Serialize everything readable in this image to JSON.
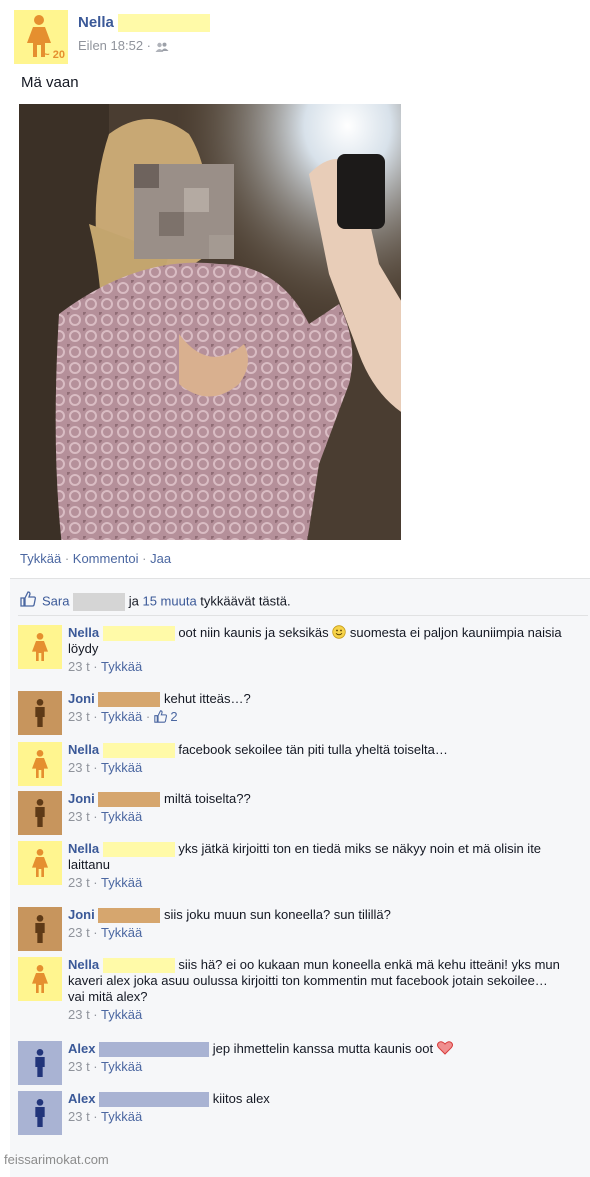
{
  "post": {
    "author": "Nella",
    "age_badge": "~ 20",
    "time": "Eilen 18:52 ·",
    "privacy_icon": "friends-icon",
    "text": "Mä vaan",
    "actions": {
      "like": "Tykkää",
      "comment": "Kommentoi",
      "share": "Jaa",
      "separator": "·"
    }
  },
  "likes": {
    "first_name": "Sara",
    "connector": "ja",
    "others_link": "15 muuta",
    "suffix": "tykkäävät tästä."
  },
  "comments": [
    {
      "author": "Nella",
      "text": "oot niin kaunis ja seksikäs",
      "emoji_after": "smiley-icon",
      "text2": "suomesta ei paljon kauniimpia naisia löydy",
      "time": "23 t",
      "like": "Tykkää",
      "avatar": "female"
    },
    {
      "author": "Joni",
      "text": "kehut itteäs…?",
      "time": "23 t",
      "like": "Tykkää",
      "like_count": "2",
      "avatar": "male-brown"
    },
    {
      "author": "Nella",
      "text": "facebook sekoilee tän piti tulla yheltä toiselta…",
      "time": "23 t",
      "like": "Tykkää",
      "avatar": "female"
    },
    {
      "author": "Joni",
      "text": "miltä toiselta??",
      "time": "23 t",
      "like": "Tykkää",
      "avatar": "male-brown"
    },
    {
      "author": "Nella",
      "text": "yks jätkä kirjoitti ton en tiedä miks se näkyy noin et mä olisin ite laittanu",
      "time": "23 t",
      "like": "Tykkää",
      "avatar": "female"
    },
    {
      "author": "Joni",
      "text": "siis joku muun sun koneella? sun tilillä?",
      "time": "23 t",
      "like": "Tykkää",
      "avatar": "male-brown"
    },
    {
      "author": "Nella",
      "text": "siis hä? ei oo kukaan mun koneella enkä mä kehu itteäni! yks mun kaveri alex joka asuu oulussa kirjoitti ton kommentin mut facebook jotain sekoilee… vai mitä alex?",
      "time": "23 t",
      "like": "Tykkää",
      "avatar": "female"
    },
    {
      "author": "Alex",
      "text": "jep ihmettelin kanssa mutta kaunis oot",
      "emoji_after": "heart-icon",
      "time": "23 t",
      "like": "Tykkää",
      "avatar": "male-blue"
    },
    {
      "author": "Alex",
      "text": "kiitos alex",
      "time": "23 t",
      "like": "Tykkää",
      "avatar": "male-blue"
    }
  ],
  "watermark": "feissarimokat.com",
  "colors": {
    "link": "#3b5998",
    "female_avatar_bg": "#fff58f",
    "female_figure": "#e58f2f",
    "male_brown_bg": "#c7955d",
    "male_brown_figure": "#5e3a17",
    "male_blue_bg": "#a9b3d3",
    "male_blue_figure": "#22357a"
  }
}
